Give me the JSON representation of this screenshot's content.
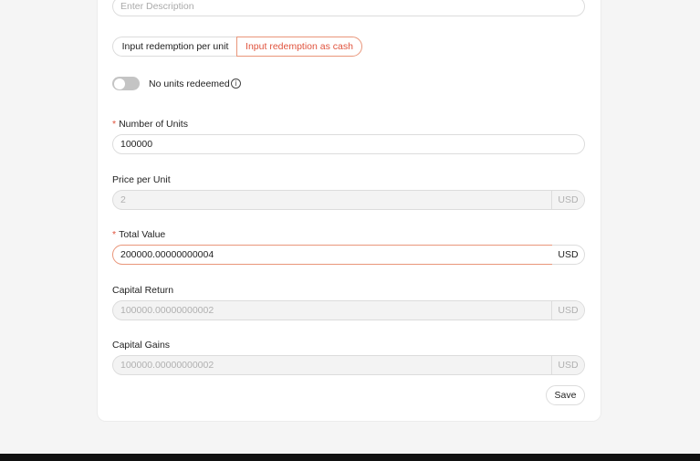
{
  "description": {
    "placeholder": "Enter Description"
  },
  "mode_tabs": [
    {
      "label": "Input redemption per unit",
      "active": false
    },
    {
      "label": "Input redemption as cash",
      "active": true
    }
  ],
  "no_units_toggle": {
    "label": "No units redeemed",
    "on": false
  },
  "fields": {
    "number_of_units": {
      "label": "Number of Units",
      "required": true,
      "value": "100000"
    },
    "price_per_unit": {
      "label": "Price per Unit",
      "value": "2",
      "suffix": "USD",
      "disabled": true
    },
    "total_value": {
      "label": "Total Value",
      "required": true,
      "value": "200000.00000000004",
      "suffix": "USD"
    },
    "capital_return": {
      "label": "Capital Return",
      "value": "100000.00000000002",
      "suffix": "USD",
      "disabled": true
    },
    "capital_gains": {
      "label": "Capital Gains",
      "value": "100000.00000000002",
      "suffix": "USD",
      "disabled": true
    }
  },
  "required_marker": "*",
  "info_glyph": "i",
  "save_label": "Save",
  "colors": {
    "accent": "#e0533d",
    "accent_border": "#e9967a",
    "disabled_bg": "#f3f3f3"
  }
}
